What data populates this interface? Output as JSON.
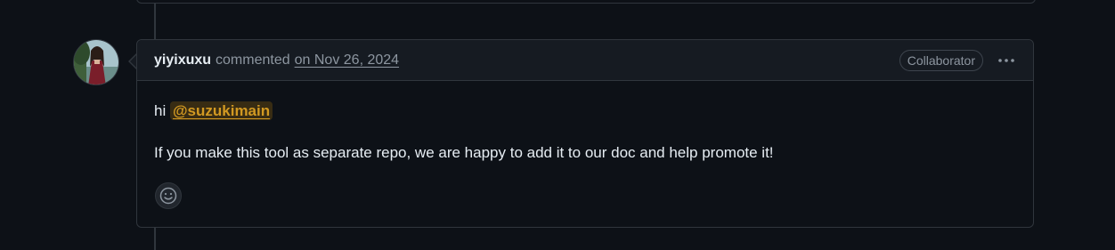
{
  "comment": {
    "author": "yiyixuxu",
    "action": "commented",
    "date": "on Nov 26, 2024",
    "role_badge": "Collaborator",
    "body": {
      "greeting": "hi",
      "mention": "@suzukimain",
      "message": "If you make this tool as separate repo, we are happy to add it to our doc and help promote it!"
    }
  },
  "icons": {
    "more": "kebab-horizontal-icon",
    "reaction": "smiley-icon",
    "avatar": "user-avatar"
  },
  "colors": {
    "background": "#0d1117",
    "header_bg": "#161b22",
    "border": "#30363d",
    "muted_text": "#8d96a0",
    "mention": "#d29922"
  }
}
